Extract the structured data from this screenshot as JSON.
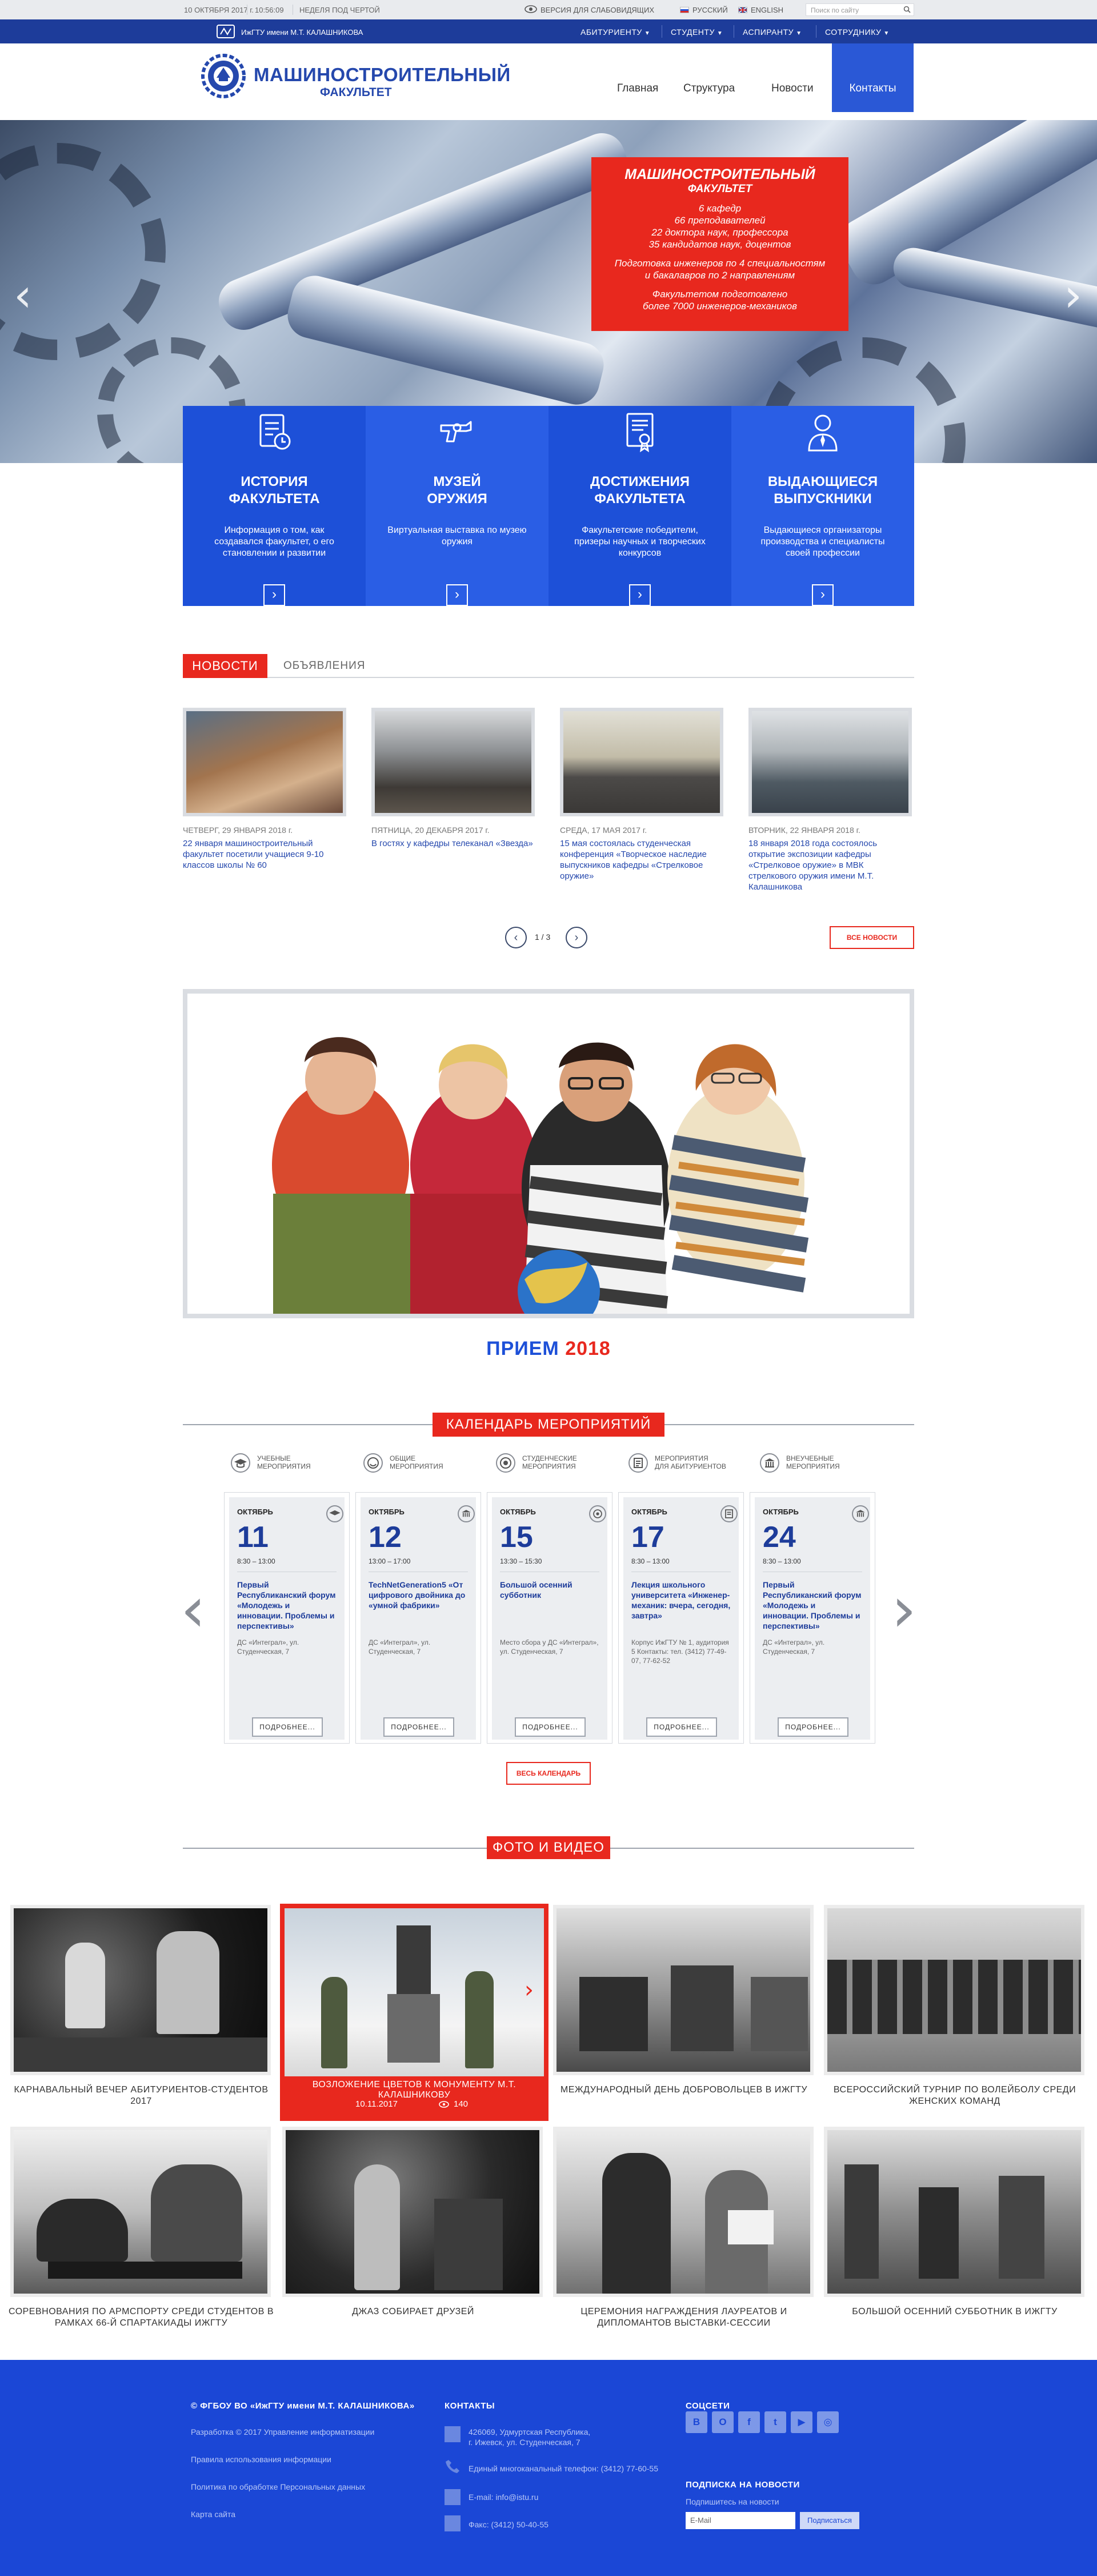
{
  "topbar": {
    "date": "10 ОКТЯБРЯ 2017 г.",
    "time": "10:56:09",
    "week": "НЕДЕЛЯ ПОД ЧЕРТОЙ",
    "low_vision": "ВЕРСИЯ ДЛЯ СЛАБОВИДЯЩИХ",
    "lang_ru": "РУССКИЙ",
    "lang_en": "ENGLISH",
    "search_placeholder": "Поиск по сайту"
  },
  "bluebar": {
    "university": "ИжГТУ имени М.Т. КАЛАШНИКОВА",
    "nav": [
      "АБИТУРИЕНТУ",
      "СТУДЕНТУ",
      "АСПИРАНТУ",
      "СОТРУДНИКУ"
    ]
  },
  "header": {
    "title_line1": "МАШИНОСТРОИТЕЛЬНЫЙ",
    "title_line2": "ФАКУЛЬТЕТ",
    "menu": [
      "Главная",
      "Структура",
      "Новости",
      "Контакты"
    ]
  },
  "promo": {
    "title": "МАШИНОСТРОИТЕЛЬНЫЙ",
    "subtitle": "ФАКУЛЬТЕТ",
    "lines1": [
      "6 кафедр",
      "66 преподавателей",
      "22 доктора наук, профессора",
      "35 кандидатов наук, доцентов"
    ],
    "lines2": [
      "Подготовка инженеров по 4 специальностям",
      "и бакалавров по 2 направлениям"
    ],
    "lines3": [
      "Факультетом подготовлено",
      "более 7000 инженеров-механиков"
    ]
  },
  "tiles": [
    {
      "title": [
        "ИСТОРИЯ",
        "ФАКУЛЬТЕТА"
      ],
      "desc": "Информация о том, как создавался факультет, о его становлении и развитии",
      "icon": "document-clock-icon",
      "color": "#1d50d8"
    },
    {
      "title": [
        "МУЗЕЙ",
        "ОРУЖИЯ"
      ],
      "desc": "Виртуальная выставка по музею оружия",
      "icon": "revolver-icon",
      "color": "#2a5ee5"
    },
    {
      "title": [
        "ДОСТИЖЕНИЯ",
        "ФАКУЛЬТЕТА"
      ],
      "desc": "Факультетские победители, призеры научных и творческих конкурсов",
      "icon": "certificate-icon",
      "color": "#1d50d8"
    },
    {
      "title": [
        "ВЫДАЮЩИЕСЯ",
        "ВЫПУСКНИКИ"
      ],
      "desc": "Выдающиеся организаторы производства и специалисты своей профессии",
      "icon": "person-tie-icon",
      "color": "#2a5ee5"
    }
  ],
  "news": {
    "tab_active": "НОВОСТИ",
    "tab_inactive": "ОБЪЯВЛЕНИЯ",
    "items": [
      {
        "date": "ЧЕТВЕРГ, 29 ЯНВАРЯ 2018 г.",
        "text": "22 января машиностроительный факультет посетили учащиеся 9-10 классов школы № 60"
      },
      {
        "date": "ПЯТНИЦА, 20 ДЕКАБРЯ 2017 г.",
        "text": "В гостях у кафедры телеканал «Звезда»"
      },
      {
        "date": "СРЕДА, 17 МАЯ 2017 г.",
        "text": "15 мая состоялась студенческая конференция «Творческое наследие выпускников кафедры «Стрелковое оружие»"
      },
      {
        "date": "ВТОРНИК, 22 ЯНВАРЯ 2018 г.",
        "text": "18 января 2018 года состоялось открытие экспозиции кафедры «Стрелковое оружие» в МВК стрелкового оружия имени М.Т. Калашникова"
      }
    ],
    "pager": "1 / 3",
    "all_news": "ВСЕ НОВОСТИ"
  },
  "admission": {
    "word": "ПРИЕМ",
    "year": "2018"
  },
  "calendar": {
    "title": "КАЛЕНДАРЬ МЕРОПРИЯТИЙ",
    "categories": [
      [
        "УЧЕБНЫЕ",
        "МЕРОПРИЯТИЯ"
      ],
      [
        "ОБЩИЕ",
        "МЕРОПРИЯТИЯ"
      ],
      [
        "СТУДЕНЧЕСКИЕ",
        "МЕРОПРИЯТИЯ"
      ],
      [
        "МЕРОПРИЯТИЯ",
        "ДЛЯ АБИТУРИЕНТОВ"
      ],
      [
        "ВНЕУЧЕБНЫЕ",
        "МЕРОПРИЯТИЯ"
      ]
    ],
    "events": [
      {
        "month": "ОКТЯБРЬ",
        "day": "11",
        "time": "8:30 – 13:00",
        "title": "Первый Республиканский форум «Молодежь и инновации. Проблемы и перспективы»",
        "place": "ДС «Интеграл», ул. Студенческая, 7"
      },
      {
        "month": "ОКТЯБРЬ",
        "day": "12",
        "time": "13:00 – 17:00",
        "title": "TechNetGeneration5 «От цифрового двойника до «умной фабрики»",
        "place": "ДС «Интеграл», ул. Студенческая, 7"
      },
      {
        "month": "ОКТЯБРЬ",
        "day": "15",
        "time": "13:30 – 15:30",
        "title": "Большой осенний субботник",
        "place": "Место сбора у ДС «Интеграл», ул. Студенческая, 7"
      },
      {
        "month": "ОКТЯБРЬ",
        "day": "17",
        "time": "8:30 – 13:00",
        "title": "Лекция школьного университета «Инженер-механик: вчера, сегодня, завтра»",
        "place": "Корпус ИжГТУ № 1, аудитория 5 Контакты: тел. (3412) 77-49-07, 77-62-52"
      },
      {
        "month": "ОКТЯБРЬ",
        "day": "24",
        "time": "8:30 – 13:00",
        "title": "Первый Республиканский форум «Молодежь и инновации. Проблемы и перспективы»",
        "place": "ДС «Интеграл», ул. Студенческая, 7"
      }
    ],
    "more": "ПОДРОБНЕЕ...",
    "all": "ВЕСЬ КАЛЕНДАРЬ"
  },
  "gallery": {
    "title": "ФОТО И ВИДЕО",
    "row1": [
      {
        "caption": "КАРНАВАЛЬНЫЙ ВЕЧЕР АБИТУРИЕНТОВ-СТУДЕНТОВ 2017"
      },
      {
        "caption": "ВОЗЛОЖЕНИЕ ЦВЕТОВ К МОНУМЕНТУ М.Т. КАЛАШНИКОВУ",
        "date": "10.11.2017",
        "views": "140"
      },
      {
        "caption": "МЕЖДУНАРОДНЫЙ ДЕНЬ ДОБРОВОЛЬЦЕВ В ИЖГТУ"
      },
      {
        "caption": "ВСЕРОССИЙСКИЙ ТУРНИР ПО ВОЛЕЙБОЛУ СРЕДИ ЖЕНСКИХ КОМАНД"
      }
    ],
    "row2": [
      {
        "caption": "СОРЕВНОВАНИЯ ПО АРМСПОРТУ СРЕДИ СТУДЕНТОВ В РАМКАХ 66-Й СПАРТАКИАДЫ ИЖГТУ"
      },
      {
        "caption": "ДЖАЗ СОБИРАЕТ ДРУЗЕЙ"
      },
      {
        "caption": "ЦЕРЕМОНИЯ НАГРАЖДЕНИЯ ЛАУРЕАТОВ И ДИПЛОМАНТОВ ВЫСТАВКИ-СЕССИИ"
      },
      {
        "caption": "БОЛЬШОЙ ОСЕННИЙ СУББОТНИК В ИЖГТУ"
      }
    ]
  },
  "footer": {
    "org": "© ФГБОУ ВО «ИжГТУ имени М.Т. КАЛАШНИКОВА»",
    "links": [
      "Разработка © 2017 Управление информатизации",
      "Правила использования информации",
      "Политика по обработке Персональных данных",
      "Карта сайта"
    ],
    "contacts_title": "КОНТАКТЫ",
    "address": [
      "426069, Удмуртская Республика,",
      "г. Ижевск, ул. Студенческая, 7"
    ],
    "phone": "Единый многоканальный телефон: (3412) 77-60-55",
    "email": "E-mail: info@istu.ru",
    "fax": "Факс: (3412) 50-40-55",
    "social_title": "СОЦСЕТИ",
    "socials": [
      "В",
      "О",
      "f",
      "t",
      "▶",
      "◎"
    ],
    "subscribe_title": "ПОДПИСКА НА НОВОСТИ",
    "subscribe_hint": "Подпишитесь на новости",
    "email_placeholder": "E-Mail",
    "subscribe_btn": "Подписаться"
  }
}
